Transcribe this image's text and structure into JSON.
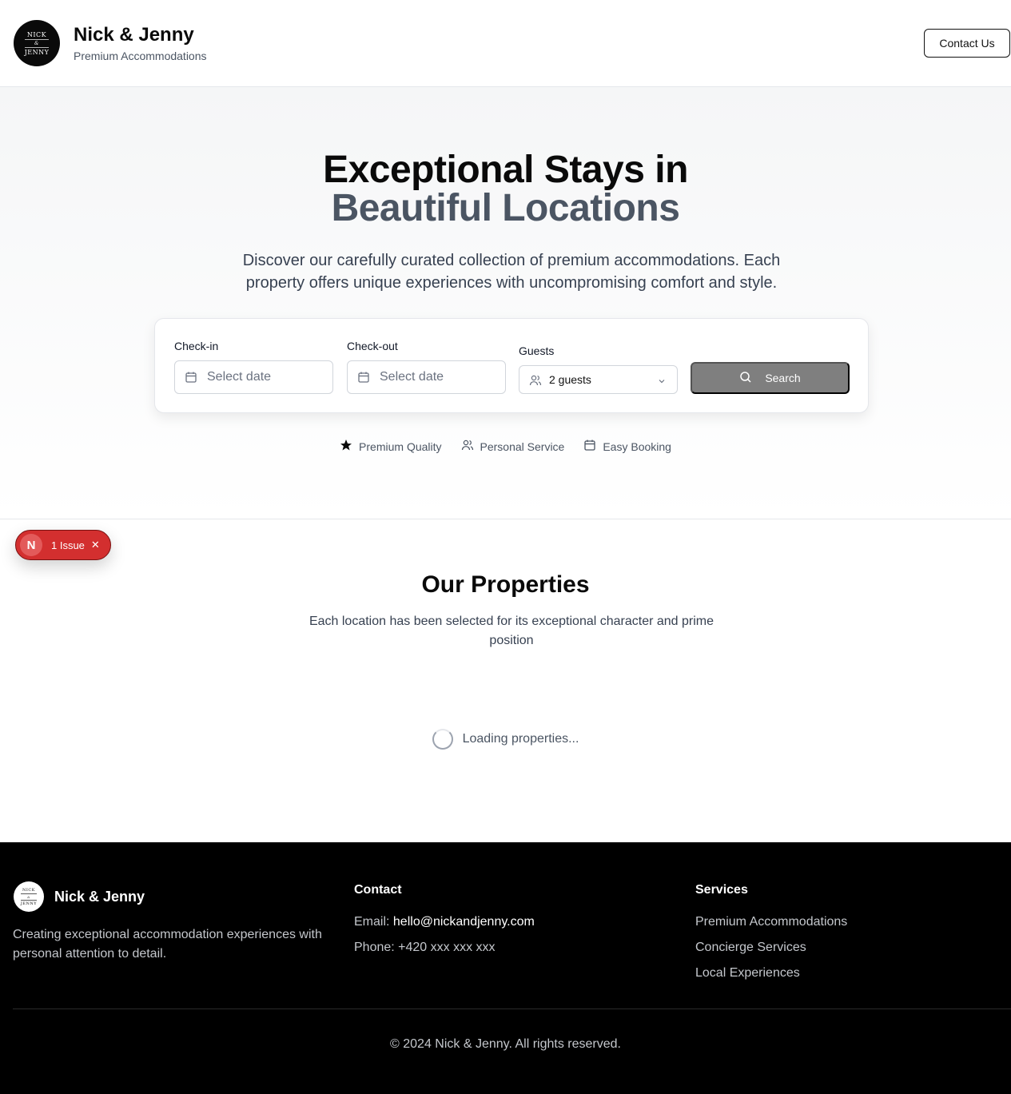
{
  "header": {
    "logo_line1": "NICK",
    "logo_amp": "&",
    "logo_line2": "JENNY",
    "brand_name": "Nick & Jenny",
    "brand_subtitle": "Premium Accommodations",
    "contact_label": "Contact Us"
  },
  "hero": {
    "title_line1": "Exceptional Stays in",
    "title_line2": "Beautiful Locations",
    "description": "Discover our carefully curated collection of premium accommodations. Each property offers unique experiences with uncompromising comfort and style."
  },
  "search": {
    "checkin_label": "Check-in",
    "checkin_placeholder": "Select date",
    "checkout_label": "Check-out",
    "checkout_placeholder": "Select date",
    "guests_label": "Guests",
    "guests_value": "2 guests",
    "button_label": "Search"
  },
  "features": [
    {
      "label": "Premium Quality",
      "icon": "star-icon"
    },
    {
      "label": "Personal Service",
      "icon": "users-icon"
    },
    {
      "label": "Easy Booking",
      "icon": "calendar-icon"
    }
  ],
  "issue_badge": {
    "initial": "N",
    "label": "1 Issue"
  },
  "properties": {
    "title": "Our Properties",
    "description": "Each location has been selected for its exceptional character and prime position",
    "loading_text": "Loading properties..."
  },
  "footer": {
    "brand_name": "Nick & Jenny",
    "tagline": "Creating exceptional accommodation experiences with personal attention to detail.",
    "contact_heading": "Contact",
    "email_label": "Email:",
    "email_value": "hello@nickandjenny.com",
    "phone_text": "Phone: +420 xxx xxx xxx",
    "services_heading": "Services",
    "services": [
      "Premium Accommodations",
      "Concierge Services",
      "Local Experiences"
    ],
    "copyright": "© 2024 Nick & Jenny. All rights reserved."
  },
  "colors": {
    "accent_dark": "#0a0a0a",
    "subtitle_gray": "#4b5563",
    "search_button": "#7f7f7f",
    "issue_red": "#d32f2f"
  }
}
